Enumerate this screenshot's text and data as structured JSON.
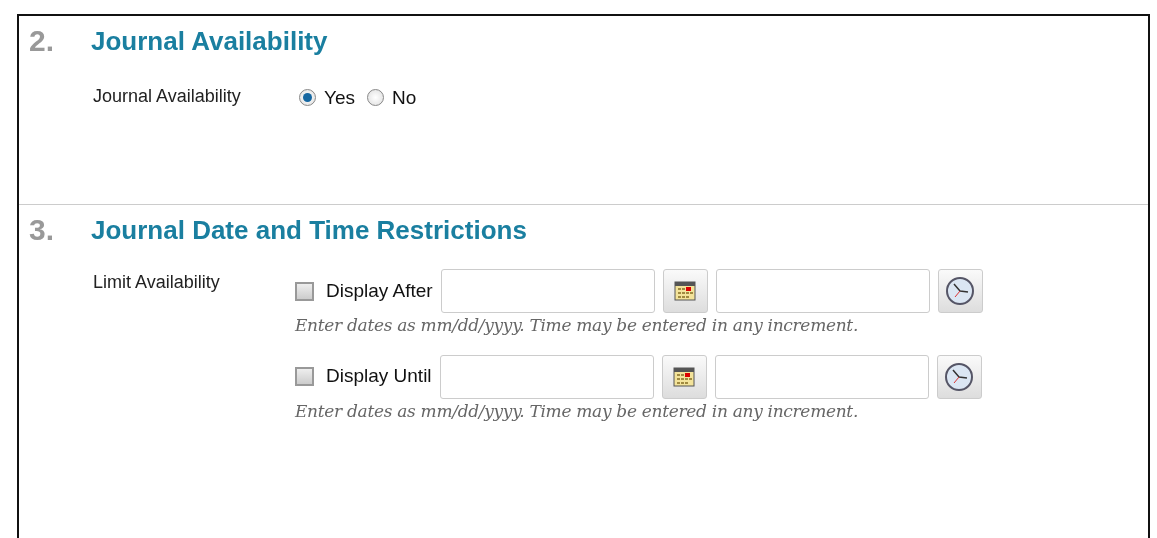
{
  "sections": [
    {
      "number": "2.",
      "title": "Journal Availability",
      "label": "Journal Availability",
      "kind": "radio",
      "options": [
        {
          "label": "Yes",
          "selected": true
        },
        {
          "label": "No",
          "selected": false
        }
      ]
    },
    {
      "number": "3.",
      "title": "Journal Date and Time Restrictions",
      "label": "Limit Availability",
      "kind": "dates",
      "rows": [
        {
          "label": "Display After",
          "checked": false,
          "hint": "Enter dates as mm/dd/yyyy. Time may be entered in any increment."
        },
        {
          "label": "Display Until",
          "checked": false,
          "hint": "Enter dates as mm/dd/yyyy. Time may be entered in any increment."
        }
      ]
    }
  ]
}
